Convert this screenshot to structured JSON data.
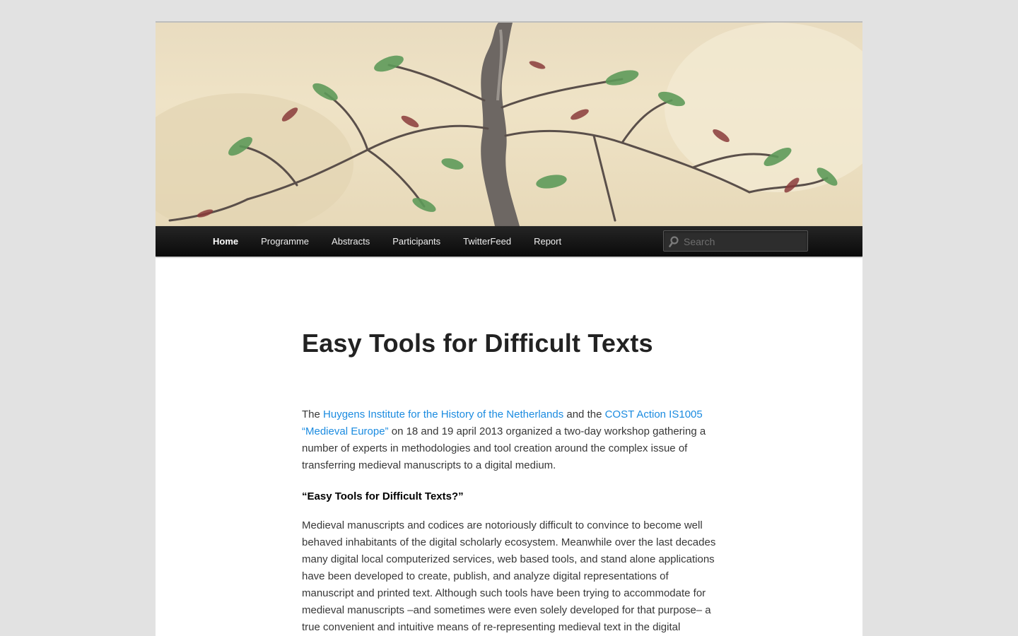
{
  "nav": {
    "items": [
      "Home",
      "Programme",
      "Abstracts",
      "Participants",
      "TwitterFeed",
      "Report"
    ],
    "active": "Home"
  },
  "search": {
    "placeholder": "Search"
  },
  "post": {
    "title": "Easy Tools for Difficult Texts",
    "intro": {
      "t1": "The ",
      "link1": "Huygens Institute for the History of the Netherlands",
      "t2": " and the ",
      "link2": "COST Action IS1005 “Medieval Europe”",
      "t3": " on 18 and 19 april 2013 organized a two-day workshop gathering a number of experts in methodologies and tool creation around the complex issue of transferring medieval manuscripts to a digital medium."
    },
    "subheading": "“Easy Tools for Difficult Texts?”",
    "body": "Medieval manuscripts and codices are notoriously difficult to convince to become well behaved inhabitants of the digital scholarly ecosystem. Meanwhile over the last decades many digital local computerized services, web based tools, and stand alone applications have been developed to create, publish, and analyze digital representations of manuscript and printed text. Although such tools have been trying to accommodate for medieval manuscripts –and sometimes were even solely developed for that purpose– a true convenient and intuitive means of re-representing medieval text in the digital medium seems elusive. The nature of medieval texts –ambiguous,"
  },
  "colors": {
    "link": "#1b8be0",
    "nav_bg": "#111111",
    "page_bg": "#e2e2e2"
  }
}
